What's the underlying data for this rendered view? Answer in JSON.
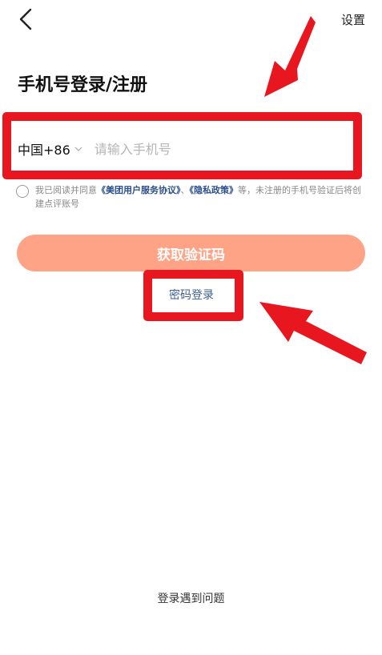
{
  "header": {
    "back_icon": "chevron-left-icon",
    "settings_label": "设置"
  },
  "title": "手机号登录/注册",
  "phone_input": {
    "country_code": "中国+86",
    "country_chevron_icon": "chevron-down-icon",
    "placeholder": "请输入手机号",
    "value": ""
  },
  "agreement": {
    "text_before": "我已阅读并同意",
    "link_user_agreement": "《美团用户服务协议》",
    "separator": "、",
    "link_privacy": "《隐私政策》",
    "text_after": "等，未注册的手机号验证后将创建点评账号",
    "checked": false
  },
  "get_code_button_label": "获取验证码",
  "password_login_label": "密码登录",
  "login_problem_label": "登录遇到问题",
  "colors": {
    "annotation_red": "#e8161f",
    "button_salmon": "#ffa386",
    "link_blue": "#2a4f8a"
  }
}
